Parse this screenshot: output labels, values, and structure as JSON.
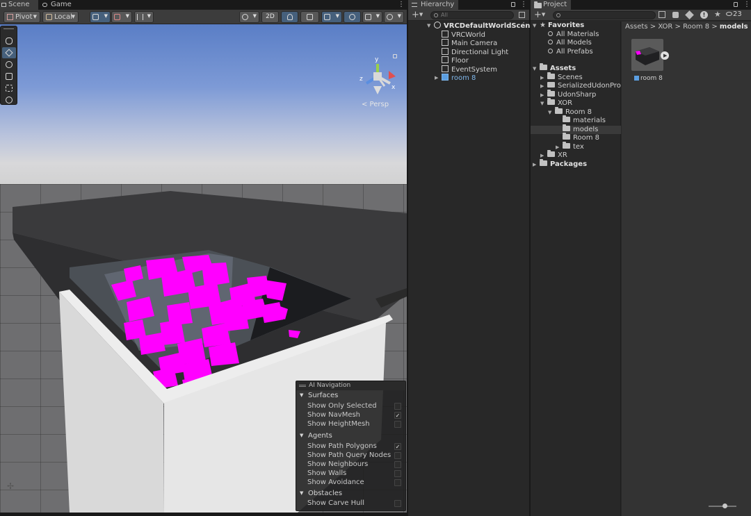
{
  "scene_tabs": {
    "scene": "Scene",
    "game": "Game"
  },
  "scene_toolbar": {
    "pivot": "Pivot",
    "local": "Local",
    "mode_2d": "2D"
  },
  "scene_view": {
    "projection_label": "< Persp",
    "gizmo_axes": {
      "x": "x",
      "y": "y",
      "z": "z"
    }
  },
  "ai_navigation": {
    "title": "AI Navigation",
    "sections": [
      {
        "label": "Surfaces",
        "items": [
          {
            "label": "Show Only Selected",
            "checked": false
          },
          {
            "label": "Show NavMesh",
            "checked": true
          },
          {
            "label": "Show HeightMesh",
            "checked": false
          }
        ]
      },
      {
        "label": "Agents",
        "items": [
          {
            "label": "Show Path Polygons",
            "checked": true
          },
          {
            "label": "Show Path Query Nodes",
            "checked": false
          },
          {
            "label": "Show Neighbours",
            "checked": false
          },
          {
            "label": "Show Walls",
            "checked": false
          },
          {
            "label": "Show Avoidance",
            "checked": false
          }
        ]
      },
      {
        "label": "Obstacles",
        "items": [
          {
            "label": "Show Carve Hull",
            "checked": false
          }
        ]
      }
    ],
    "check_mark": "✓"
  },
  "hierarchy": {
    "tab": "Hierarchy",
    "search_placeholder": "All",
    "scene_name": "VRCDefaultWorldScen",
    "objects": [
      "VRCWorld",
      "Main Camera",
      "Directional Light",
      "Floor",
      "EventSystem"
    ],
    "prefab": "room 8"
  },
  "project": {
    "tab": "Project",
    "hidden_count": "23",
    "favorites": {
      "label": "Favorites",
      "items": [
        "All Materials",
        "All Models",
        "All Prefabs"
      ]
    },
    "assets": {
      "label": "Assets",
      "children": [
        "Scenes",
        "SerializedUdonProgra",
        "UdonSharp",
        "XOR"
      ],
      "xor_children": [
        "Room 8"
      ],
      "room8_children": [
        "materials",
        "models",
        "Room 8",
        "tex"
      ],
      "xr": "XR"
    },
    "packages": "Packages",
    "breadcrumb": [
      "Assets",
      "XOR",
      "Room 8",
      "models"
    ],
    "breadcrumb_sep": ">",
    "asset_name": "room 8"
  },
  "colors": {
    "accent_blue": "#46607c",
    "selection_bg": "#3a3a3a",
    "navmesh_magenta": "#ff00ff",
    "prefab_blue": "#7fb6ea"
  }
}
